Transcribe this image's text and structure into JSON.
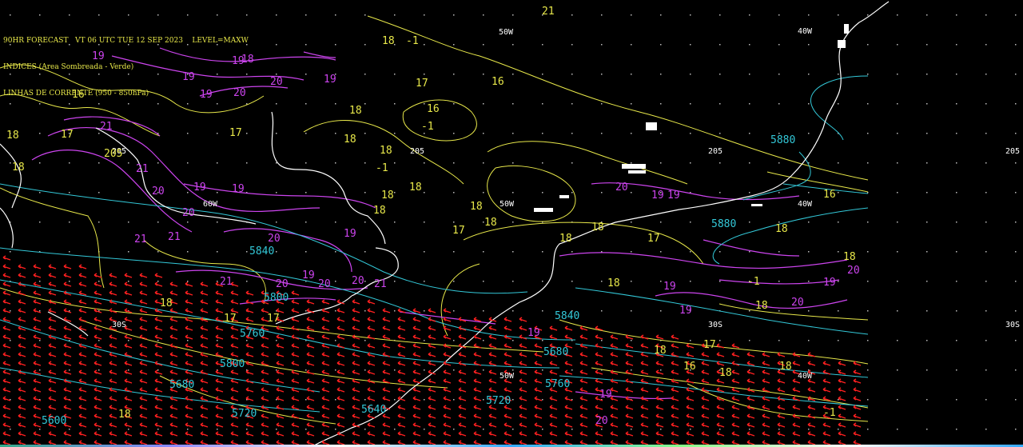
{
  "header": {
    "line1": "90HR FORECAST   VT 06 UTC TUE 12 SEP 2023    LEVEL=MAXW",
    "line2": "INDICES (Area Sombreada - Verde)",
    "line3": "LINHAS DE CORRENTE (950 - 850hPa)"
  },
  "colors": {
    "background": "#000000",
    "coast": "#ffffff",
    "index_contour": "#e8e84a",
    "streamline": "#cc44ee",
    "geopotential": "#33c8d8",
    "wind_arrows": "#ff2020"
  },
  "grid_labels": [
    {
      "text": "50W"
    },
    {
      "text": "40W"
    },
    {
      "text": "205"
    },
    {
      "text": "205"
    },
    {
      "text": "205"
    },
    {
      "text": "205"
    },
    {
      "text": "60W"
    },
    {
      "text": "50W"
    },
    {
      "text": "40W"
    },
    {
      "text": "30S"
    },
    {
      "text": "30S"
    },
    {
      "text": "30S"
    },
    {
      "text": "50W"
    },
    {
      "text": "40W"
    }
  ],
  "index_labels": [
    "18",
    "-1",
    "21",
    "16",
    "17",
    "16",
    "18",
    "-1",
    "18",
    "17",
    "16",
    "17",
    "18",
    "18",
    "205",
    "-1",
    "18",
    "18",
    "18",
    "17",
    "18",
    "18",
    "17",
    "18",
    "18",
    "17",
    "18",
    "16",
    "18",
    "17",
    "17",
    "18",
    "16",
    "18",
    "18",
    "-1",
    "18",
    "18",
    "18",
    "18",
    "-1",
    "18"
  ],
  "streamline_labels": [
    "19",
    "19",
    "19",
    "18",
    "20",
    "19",
    "19",
    "20",
    "21",
    "21",
    "19",
    "19",
    "20",
    "20",
    "19",
    "20",
    "19",
    "20",
    "20",
    "21",
    "21",
    "20",
    "21",
    "21",
    "20",
    "19",
    "19",
    "19",
    "19",
    "20",
    "19",
    "20",
    "19",
    "19",
    "20"
  ],
  "geopotential_labels": [
    "5880",
    "5880",
    "5840",
    "5800",
    "5840",
    "5760",
    "5800",
    "5720",
    "5680",
    "5760",
    "5720",
    "5640",
    "5600",
    "5680"
  ]
}
